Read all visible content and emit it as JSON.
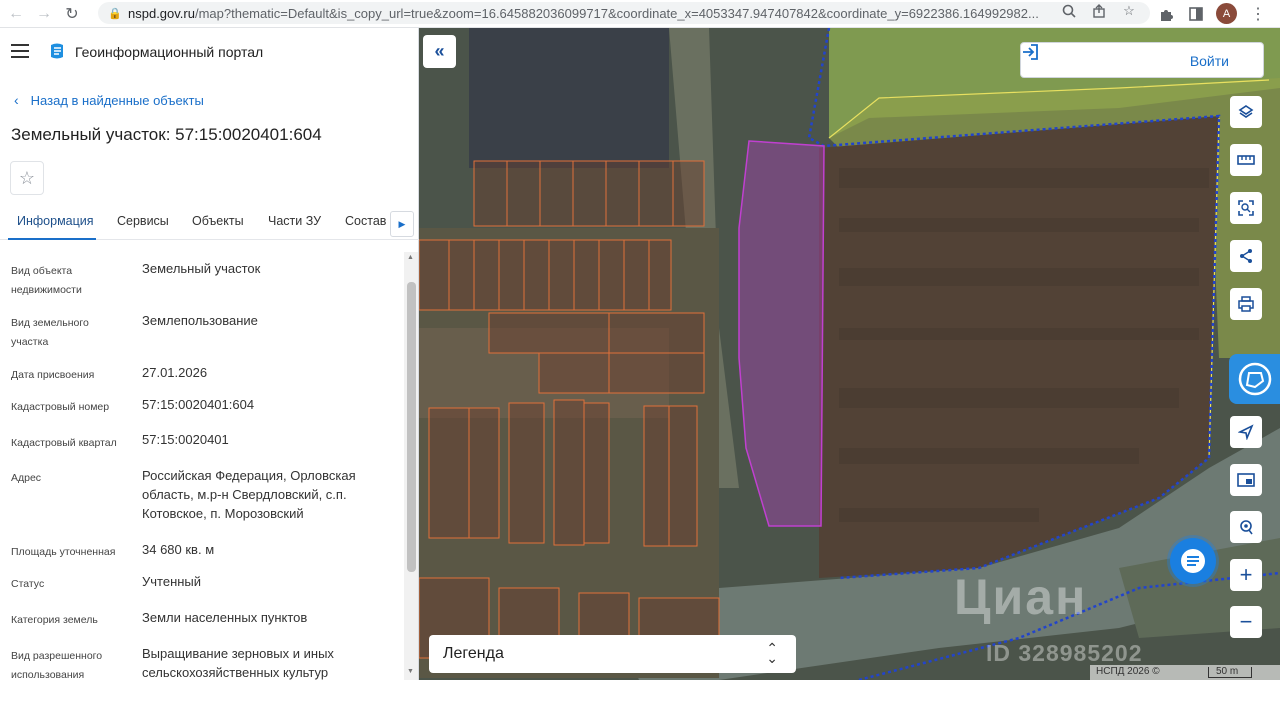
{
  "browser": {
    "url_host": "nspd.gov.ru",
    "url_rest": "/map?thematic=Default&is_copy_url=true&zoom=16.645882036099717&coordinate_x=4053347.947407842&coordinate_y=6922386.164992982...",
    "avatar_letter": "А"
  },
  "app": {
    "title": "Геоинформационный портал",
    "back_link": "Назад в найденные объекты",
    "object_title": "Земельный участок: 57:15:0020401:604"
  },
  "tabs": [
    {
      "label": "Информация"
    },
    {
      "label": "Сервисы"
    },
    {
      "label": "Объекты"
    },
    {
      "label": "Части ЗУ"
    },
    {
      "label": "Состав"
    }
  ],
  "properties": [
    {
      "label": "Вид объекта недвижимости",
      "value": "Земельный участок"
    },
    {
      "label": "Вид земельного участка",
      "value": "Землепользование"
    },
    {
      "label": "Дата присвоения",
      "value": "27.01.2026"
    },
    {
      "label": "Кадастровый номер",
      "value": "57:15:0020401:604"
    },
    {
      "label": "Кадастровый квартал",
      "value": "57:15:0020401"
    },
    {
      "label": "Адрес",
      "value": "Российская Федерация, Орловская область, м.р-н Свердловский, с.п. Котовское, п. Морозовский"
    },
    {
      "label": "Площадь уточненная",
      "value": "34 680 кв. м"
    },
    {
      "label": "Статус",
      "value": "Учтенный"
    },
    {
      "label": "Категория земель",
      "value": "Земли населенных пунктов"
    },
    {
      "label": "Вид разрешенного использования",
      "value": "Выращивание зерновых и иных сельскохозяйственных культур"
    }
  ],
  "map": {
    "login_label": "Войти",
    "legend_label": "Легенда",
    "attribution": "НСПД 2026 ©",
    "scale_label": "50 m",
    "watermark": "Циан",
    "watermark_id": "ID 328985202"
  },
  "colors": {
    "accent": "#1a6fc9",
    "parcel_highlight": "#c040d0",
    "boundary_blue": "#2244cc",
    "cadastral_orange": "#e0703a",
    "zone_yellow": "#e8e060"
  }
}
